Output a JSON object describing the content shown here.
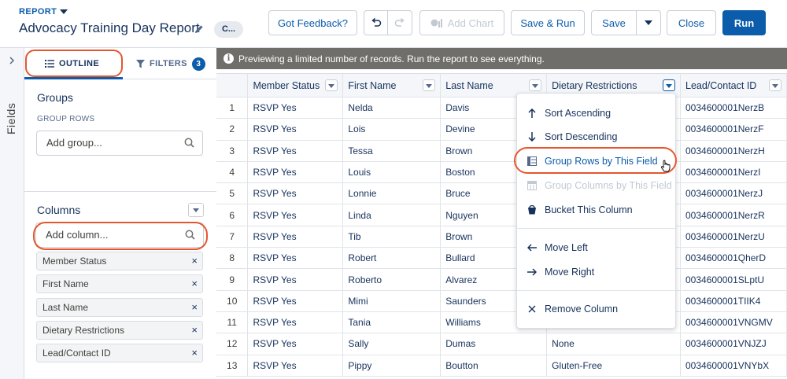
{
  "header": {
    "report_type": "REPORT",
    "title": "Advocacy Training Day Report",
    "pill": "C...",
    "buttons": {
      "feedback": "Got Feedback?",
      "add_chart": "Add Chart",
      "save_run": "Save & Run",
      "save": "Save",
      "close": "Close",
      "run": "Run"
    }
  },
  "sidebar": {
    "rail_label": "Fields",
    "tabs": {
      "outline": "OUTLINE",
      "filters": "FILTERS",
      "filters_count": "3"
    },
    "groups": {
      "title": "Groups",
      "sub_label": "GROUP ROWS",
      "placeholder": "Add group..."
    },
    "columns": {
      "title": "Columns",
      "placeholder": "Add column...",
      "items": [
        "Member Status",
        "First Name",
        "Last Name",
        "Dietary Restrictions",
        "Lead/Contact ID"
      ]
    }
  },
  "banner": {
    "text": "Previewing a limited number of records. Run the report to see everything."
  },
  "table": {
    "headers": [
      "Member Status",
      "First Name",
      "Last Name",
      "Dietary Restrictions",
      "Lead/Contact ID"
    ],
    "rows": [
      [
        "1",
        "RSVP Yes",
        "Nelda",
        "Davis",
        "",
        "0034600001NerzB"
      ],
      [
        "2",
        "RSVP Yes",
        "Lois",
        "Devine",
        "",
        "0034600001NerzF"
      ],
      [
        "3",
        "RSVP Yes",
        "Tessa",
        "Brown",
        "",
        "0034600001NerzH"
      ],
      [
        "4",
        "RSVP Yes",
        "Louis",
        "Boston",
        "",
        "0034600001NerzI"
      ],
      [
        "5",
        "RSVP Yes",
        "Lonnie",
        "Bruce",
        "",
        "0034600001NerzJ"
      ],
      [
        "6",
        "RSVP Yes",
        "Linda",
        "Nguyen",
        "",
        "0034600001NerzR"
      ],
      [
        "7",
        "RSVP Yes",
        "Tib",
        "Brown",
        "",
        "0034600001NerzU"
      ],
      [
        "8",
        "RSVP Yes",
        "Robert",
        "Bullard",
        "",
        "0034600001QherD"
      ],
      [
        "9",
        "RSVP Yes",
        "Roberto",
        "Alvarez",
        "",
        "0034600001SLptU"
      ],
      [
        "10",
        "RSVP Yes",
        "Mimi",
        "Saunders",
        "",
        "0034600001TIIK4"
      ],
      [
        "11",
        "RSVP Yes",
        "Tania",
        "Williams",
        "",
        "0034600001VNGMV"
      ],
      [
        "12",
        "RSVP Yes",
        "Sally",
        "Dumas",
        "None",
        "0034600001VNJZJ"
      ],
      [
        "13",
        "RSVP Yes",
        "Pippy",
        "Boutton",
        "Gluten-Free",
        "0034600001VNYbX"
      ]
    ]
  },
  "column_menu": {
    "items": [
      {
        "label": "Sort Ascending",
        "icon": "arrow-up-icon",
        "state": "normal"
      },
      {
        "label": "Sort Descending",
        "icon": "arrow-down-icon",
        "state": "normal"
      },
      {
        "label": "Group Rows by This Field",
        "icon": "group-rows-icon",
        "state": "hover"
      },
      {
        "label": "Group Columns by This Field",
        "icon": "group-columns-icon",
        "state": "disabled"
      },
      {
        "label": "Bucket This Column",
        "icon": "bucket-icon",
        "state": "normal"
      },
      {
        "label": "Move Left",
        "icon": "arrow-left-icon",
        "state": "normal"
      },
      {
        "label": "Move Right",
        "icon": "arrow-right-icon",
        "state": "normal"
      },
      {
        "label": "Remove Column",
        "icon": "close-icon",
        "state": "normal"
      }
    ]
  },
  "colors": {
    "brand": "#0b5cab",
    "highlight": "#e4572e",
    "banner": "#706e6b"
  }
}
